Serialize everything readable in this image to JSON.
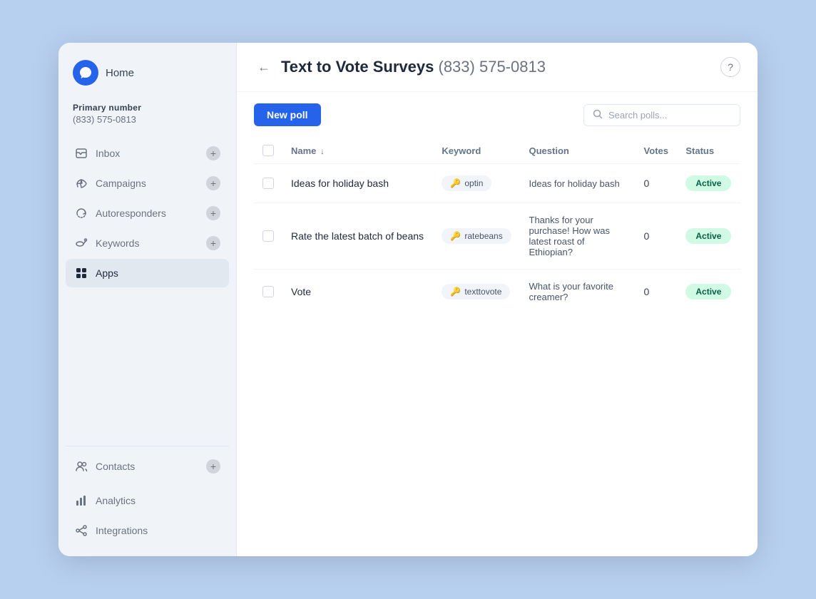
{
  "sidebar": {
    "logo": {
      "icon": "💬",
      "label": "Home"
    },
    "primary_number": {
      "label": "Primary number",
      "value": "(833) 575-0813"
    },
    "nav_items": [
      {
        "id": "inbox",
        "label": "Inbox",
        "icon": "💬",
        "has_add": true
      },
      {
        "id": "campaigns",
        "label": "Campaigns",
        "icon": "📣",
        "has_add": true
      },
      {
        "id": "autoresponders",
        "label": "Autoresponders",
        "icon": "🔄",
        "has_add": true
      },
      {
        "id": "keywords",
        "label": "Keywords",
        "icon": "🔑",
        "has_add": true
      },
      {
        "id": "apps",
        "label": "Apps",
        "icon": "⊞",
        "has_add": false,
        "active": true
      }
    ],
    "divider_items": [
      {
        "id": "contacts",
        "label": "Contacts",
        "icon": "👥",
        "has_add": true
      }
    ],
    "bottom_items": [
      {
        "id": "analytics",
        "label": "Analytics",
        "icon": "📊"
      },
      {
        "id": "integrations",
        "label": "Integrations",
        "icon": "🔗"
      }
    ]
  },
  "header": {
    "title": "Text to Vote Surveys",
    "phone": "(833) 575-0813",
    "back_label": "←"
  },
  "toolbar": {
    "new_poll_label": "New poll",
    "search_placeholder": "Search polls..."
  },
  "table": {
    "columns": [
      {
        "id": "name",
        "label": "Name",
        "sortable": true
      },
      {
        "id": "keyword",
        "label": "Keyword"
      },
      {
        "id": "question",
        "label": "Question"
      },
      {
        "id": "votes",
        "label": "Votes"
      },
      {
        "id": "status",
        "label": "Status"
      }
    ],
    "rows": [
      {
        "name": "Ideas for holiday bash",
        "keyword": "optin",
        "question": "Ideas for holiday bash",
        "votes": "0",
        "status": "Active"
      },
      {
        "name": "Rate the latest batch of beans",
        "keyword": "ratebeans",
        "question": "Thanks for your purchase! How was latest roast of Ethiopian?",
        "votes": "0",
        "status": "Active"
      },
      {
        "name": "Vote",
        "keyword": "texttovote",
        "question": "What is your favorite creamer?",
        "votes": "0",
        "status": "Active"
      }
    ]
  }
}
